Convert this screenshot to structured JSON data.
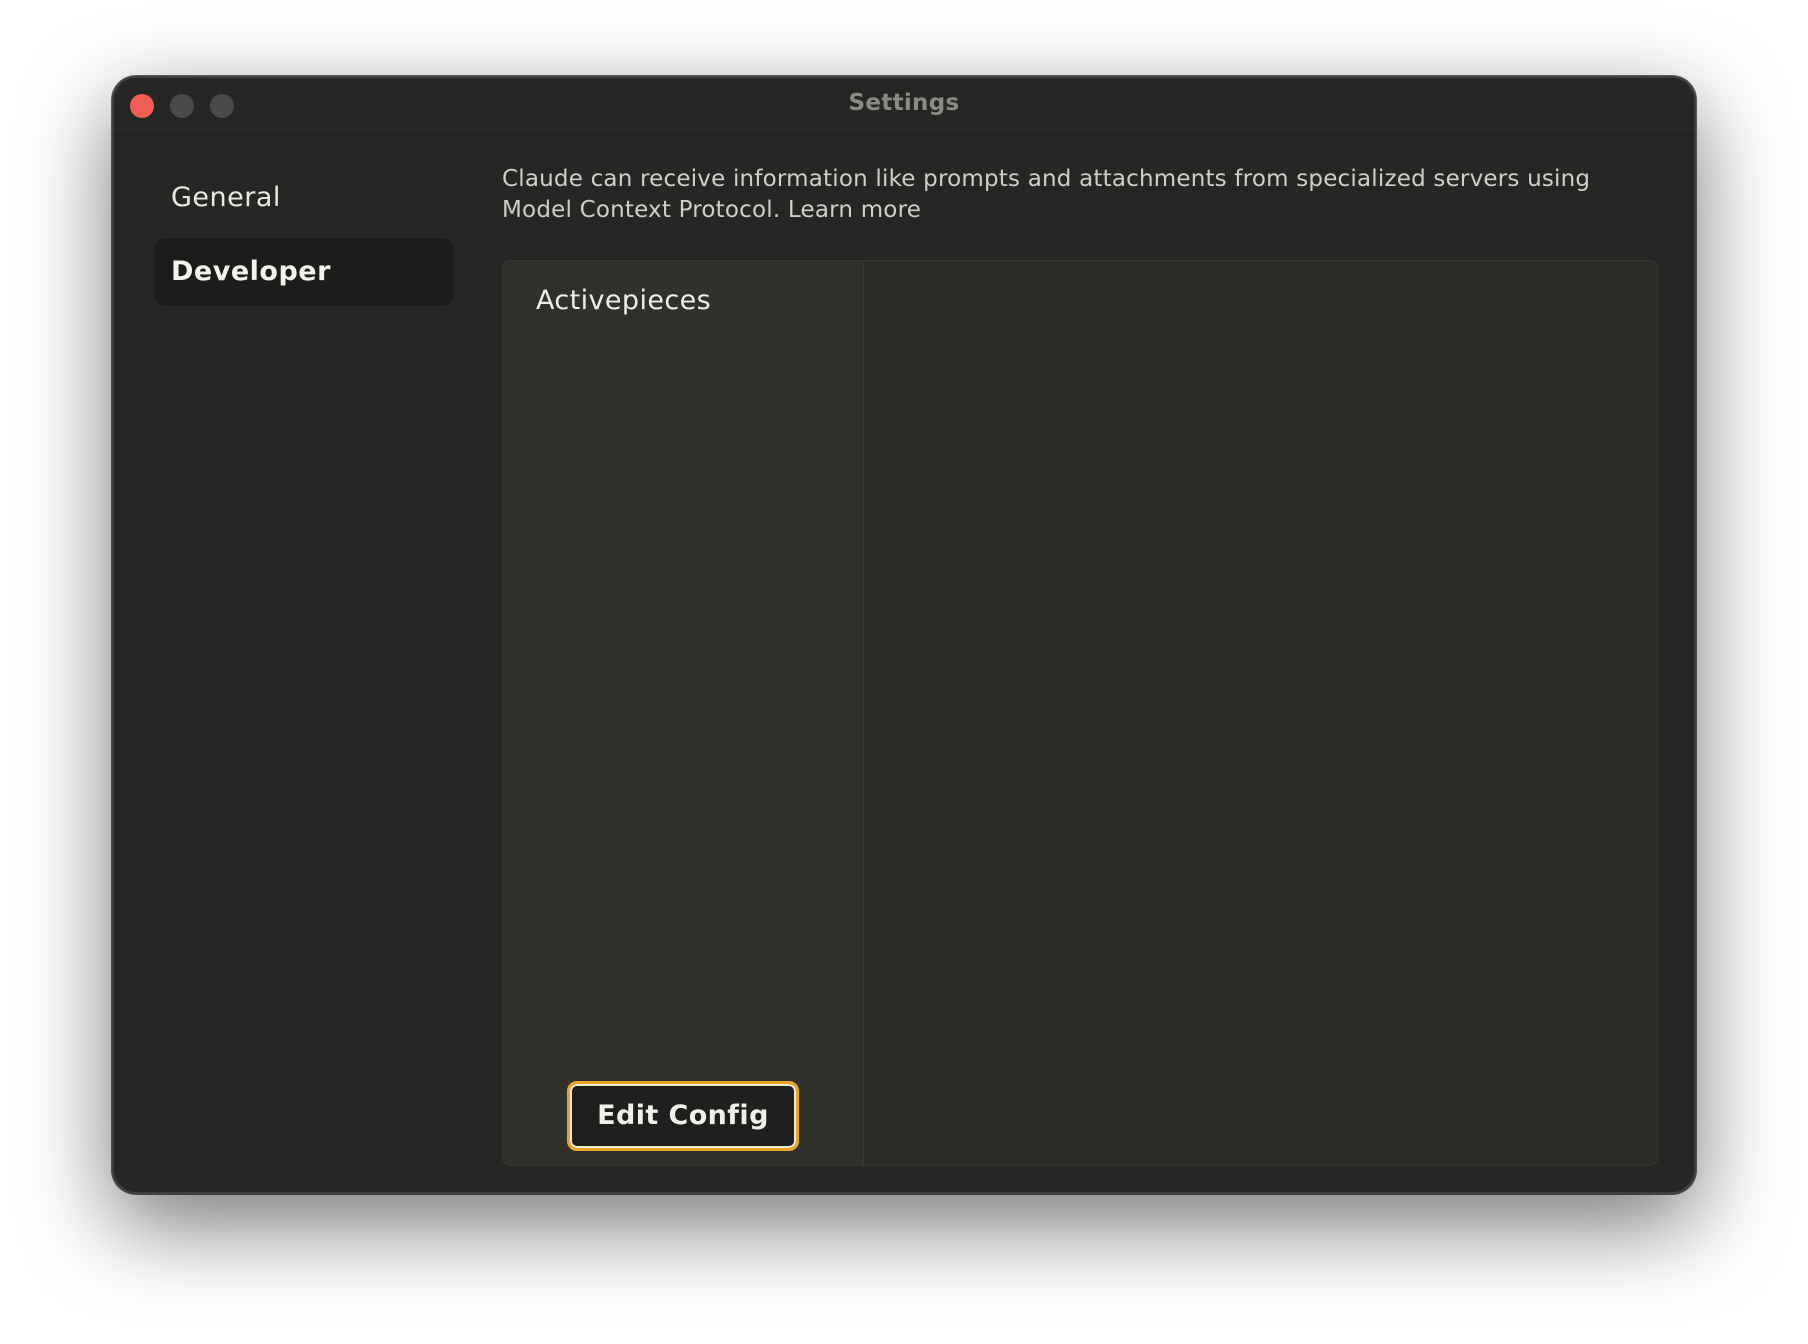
{
  "window": {
    "title": "Settings"
  },
  "sidebar": {
    "items": [
      {
        "label": "General",
        "active": false
      },
      {
        "label": "Developer",
        "active": true
      }
    ]
  },
  "main": {
    "description": "Claude can receive information like prompts and attachments from specialized servers using Model Context Protocol.",
    "learn_more": "Learn more",
    "servers": [
      {
        "name": "Activepieces"
      }
    ],
    "edit_config_label": "Edit Config"
  },
  "colors": {
    "window_bg": "#262624",
    "close_button": "#ee5f56",
    "focus_ring": "#e9a52c"
  }
}
